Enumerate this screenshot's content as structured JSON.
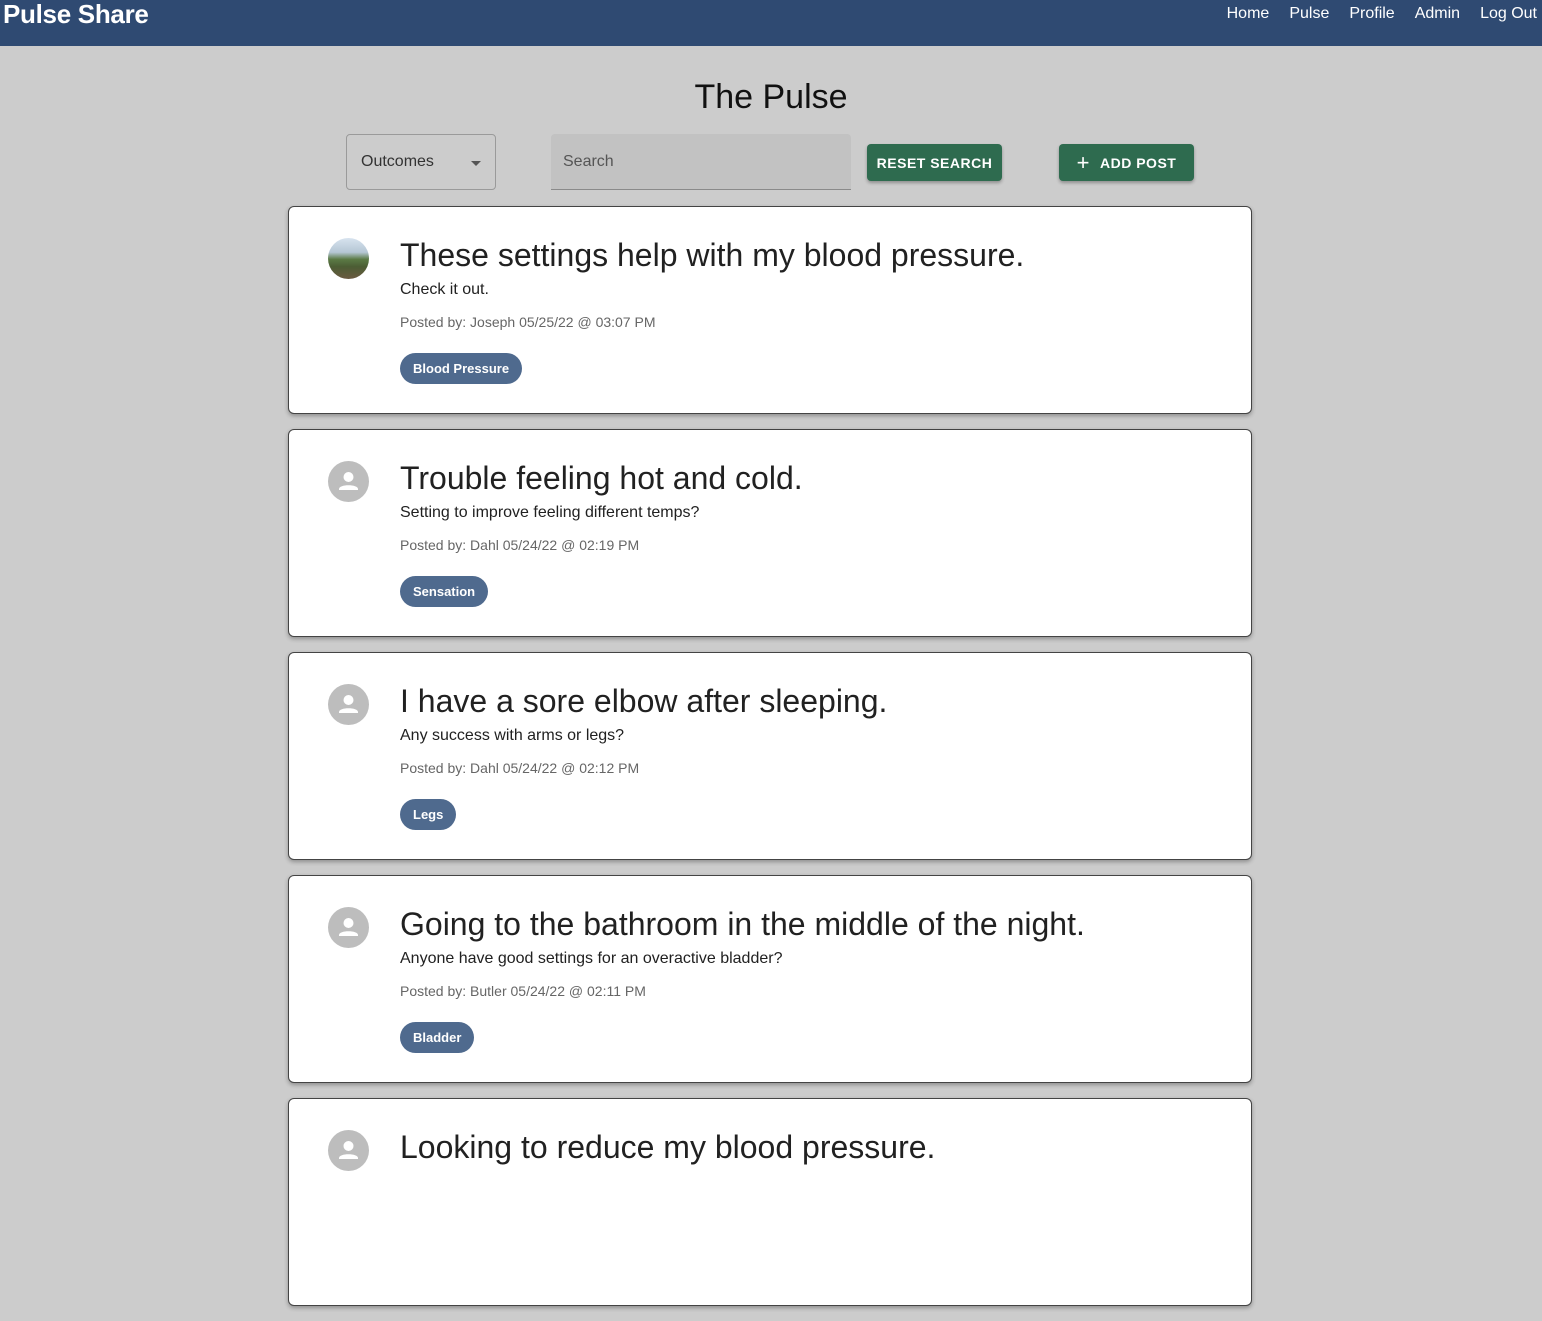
{
  "nav": {
    "brand": "Pulse Share",
    "links": [
      "Home",
      "Pulse",
      "Profile",
      "Admin",
      "Log Out"
    ]
  },
  "page": {
    "title": "The Pulse"
  },
  "filters": {
    "select_value": "Outcomes",
    "search_placeholder": "Search",
    "reset_label": "RESET SEARCH",
    "add_label": "ADD POST"
  },
  "colors": {
    "navbar": "#2f4a72",
    "button_green": "#2e6b4f",
    "tag_blue": "#4f6a8e",
    "background": "#cccccc"
  },
  "posts": [
    {
      "title": "These settings help with my blood pressure.",
      "body": "Check it out.",
      "meta": "Posted by: Joseph 05/25/22 @ 03:07 PM",
      "tag": "Blood Pressure",
      "avatar": "photo"
    },
    {
      "title": "Trouble feeling hot and cold.",
      "body": "Setting to improve feeling different temps?",
      "meta": "Posted by: Dahl 05/24/22 @ 02:19 PM",
      "tag": "Sensation",
      "avatar": "person-icon"
    },
    {
      "title": "I have a sore elbow after sleeping.",
      "body": "Any success with arms or legs?",
      "meta": "Posted by: Dahl 05/24/22 @ 02:12 PM",
      "tag": "Legs",
      "avatar": "person-icon"
    },
    {
      "title": "Going to the bathroom in the middle of the night.",
      "body": "Anyone have good settings for an overactive bladder?",
      "meta": "Posted by: Butler 05/24/22 @ 02:11 PM",
      "tag": "Bladder",
      "avatar": "person-icon"
    },
    {
      "title": "Looking to reduce my blood pressure.",
      "avatar": "person-icon"
    }
  ]
}
